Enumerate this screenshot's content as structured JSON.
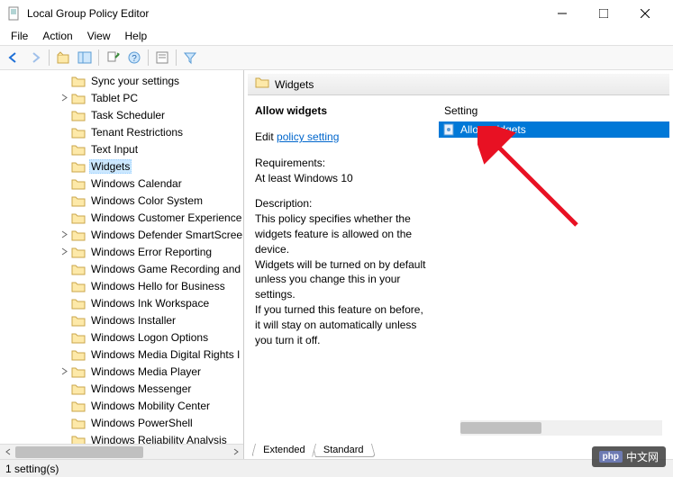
{
  "window": {
    "title": "Local Group Policy Editor"
  },
  "menu": {
    "file": "File",
    "action": "Action",
    "view": "View",
    "help": "Help"
  },
  "tree": {
    "items": [
      {
        "label": "Sync your settings",
        "indent": 66,
        "expandable": false
      },
      {
        "label": "Tablet PC",
        "indent": 66,
        "expandable": true
      },
      {
        "label": "Task Scheduler",
        "indent": 66,
        "expandable": false
      },
      {
        "label": "Tenant Restrictions",
        "indent": 66,
        "expandable": false
      },
      {
        "label": "Text Input",
        "indent": 66,
        "expandable": false
      },
      {
        "label": "Widgets",
        "indent": 66,
        "expandable": false,
        "selected": true
      },
      {
        "label": "Windows Calendar",
        "indent": 66,
        "expandable": false
      },
      {
        "label": "Windows Color System",
        "indent": 66,
        "expandable": false
      },
      {
        "label": "Windows Customer Experience",
        "indent": 66,
        "expandable": false
      },
      {
        "label": "Windows Defender SmartScreen",
        "indent": 66,
        "expandable": true
      },
      {
        "label": "Windows Error Reporting",
        "indent": 66,
        "expandable": true
      },
      {
        "label": "Windows Game Recording and",
        "indent": 66,
        "expandable": false
      },
      {
        "label": "Windows Hello for Business",
        "indent": 66,
        "expandable": false
      },
      {
        "label": "Windows Ink Workspace",
        "indent": 66,
        "expandable": false
      },
      {
        "label": "Windows Installer",
        "indent": 66,
        "expandable": false
      },
      {
        "label": "Windows Logon Options",
        "indent": 66,
        "expandable": false
      },
      {
        "label": "Windows Media Digital Rights I",
        "indent": 66,
        "expandable": false
      },
      {
        "label": "Windows Media Player",
        "indent": 66,
        "expandable": true
      },
      {
        "label": "Windows Messenger",
        "indent": 66,
        "expandable": false
      },
      {
        "label": "Windows Mobility Center",
        "indent": 66,
        "expandable": false
      },
      {
        "label": "Windows PowerShell",
        "indent": 66,
        "expandable": false
      },
      {
        "label": "Windows Reliability Analysis",
        "indent": 66,
        "expandable": false
      }
    ]
  },
  "detail": {
    "header": "Widgets",
    "title": "Allow widgets",
    "edit_prefix": "Edit ",
    "edit_link": "policy setting ",
    "req_label": "Requirements:",
    "req_text": "At least Windows 10",
    "desc_label": "Description:",
    "desc_text1": "This policy specifies whether the widgets feature is allowed on the device.",
    "desc_text2": "Widgets will be turned on by default unless you change this in your settings.",
    "desc_text3": "If you turned this feature on before, it will stay on automatically unless you turn it off."
  },
  "settings": {
    "column": "Setting",
    "rows": [
      {
        "label": "Allow widgets",
        "selected": true
      }
    ]
  },
  "tabs": {
    "extended": "Extended",
    "standard": "Standard"
  },
  "status": {
    "text": "1 setting(s)"
  },
  "watermark": {
    "badge": "php",
    "text": "中文网"
  }
}
